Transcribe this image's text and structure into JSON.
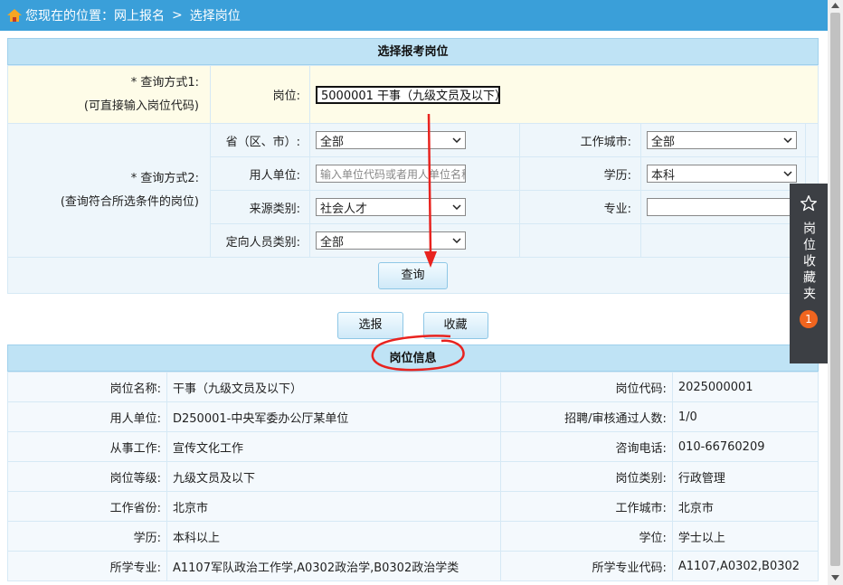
{
  "breadcrumb": {
    "prefix": "您现在的位置：",
    "item1": "网上报名",
    "separator": ">",
    "item2": "选择岗位"
  },
  "query": {
    "title": "选择报考岗位",
    "method1_label": "* 查询方式1:",
    "method1_hint": "(可直接输入岗位代码)",
    "post_label": "岗位:",
    "post_value": "5000001 干事（九级文员及以下）",
    "method2_label": "* 查询方式2:",
    "method2_hint": "(查询符合所选条件的岗位)",
    "province_label": "省（区、市）:",
    "province_value": "全部",
    "city_label": "工作城市:",
    "city_value": "全部",
    "employer_label": "用人单位:",
    "employer_placeholder": "输入单位代码或者用人单位名称",
    "education_label": "学历:",
    "education_value": "本科",
    "source_label": "来源类别:",
    "source_value": "社会人才",
    "major_label": "专业:",
    "major_value": "",
    "directed_label": "定向人员类别:",
    "directed_value": "全部",
    "search_button": "查询"
  },
  "actions": {
    "select_button": "选报",
    "favorite_button": "收藏"
  },
  "info": {
    "title": "岗位信息",
    "rows": [
      {
        "l1": "岗位名称:",
        "v1": "干事（九级文员及以下）",
        "l2": "岗位代码:",
        "v2": "2025000001"
      },
      {
        "l1": "用人单位:",
        "v1": "D250001-中央军委办公厅某单位",
        "l2": "招聘/审核通过人数:",
        "v2": "1/0"
      },
      {
        "l1": "从事工作:",
        "v1": "宣传文化工作",
        "l2": "咨询电话:",
        "v2": "010-66760209"
      },
      {
        "l1": "岗位等级:",
        "v1": "九级文员及以下",
        "l2": "岗位类别:",
        "v2": "行政管理"
      },
      {
        "l1": "工作省份:",
        "v1": "北京市",
        "l2": "工作城市:",
        "v2": "北京市"
      },
      {
        "l1": "学历:",
        "v1": "本科以上",
        "l2": "学位:",
        "v2": "学士以上"
      },
      {
        "l1": "所学专业:",
        "v1": "A1107军队政治工作学,A0302政治学,B0302政治学类",
        "l2": "所学专业代码:",
        "v2": "A1107,A0302,B0302"
      }
    ]
  },
  "favorites_panel": {
    "label": "岗位收藏夹",
    "count": "1"
  },
  "colors": {
    "topbar": "#3a9fd9",
    "section_header": "#bfe3f5",
    "annotation": "#e8231f",
    "badge": "#f0651f"
  }
}
